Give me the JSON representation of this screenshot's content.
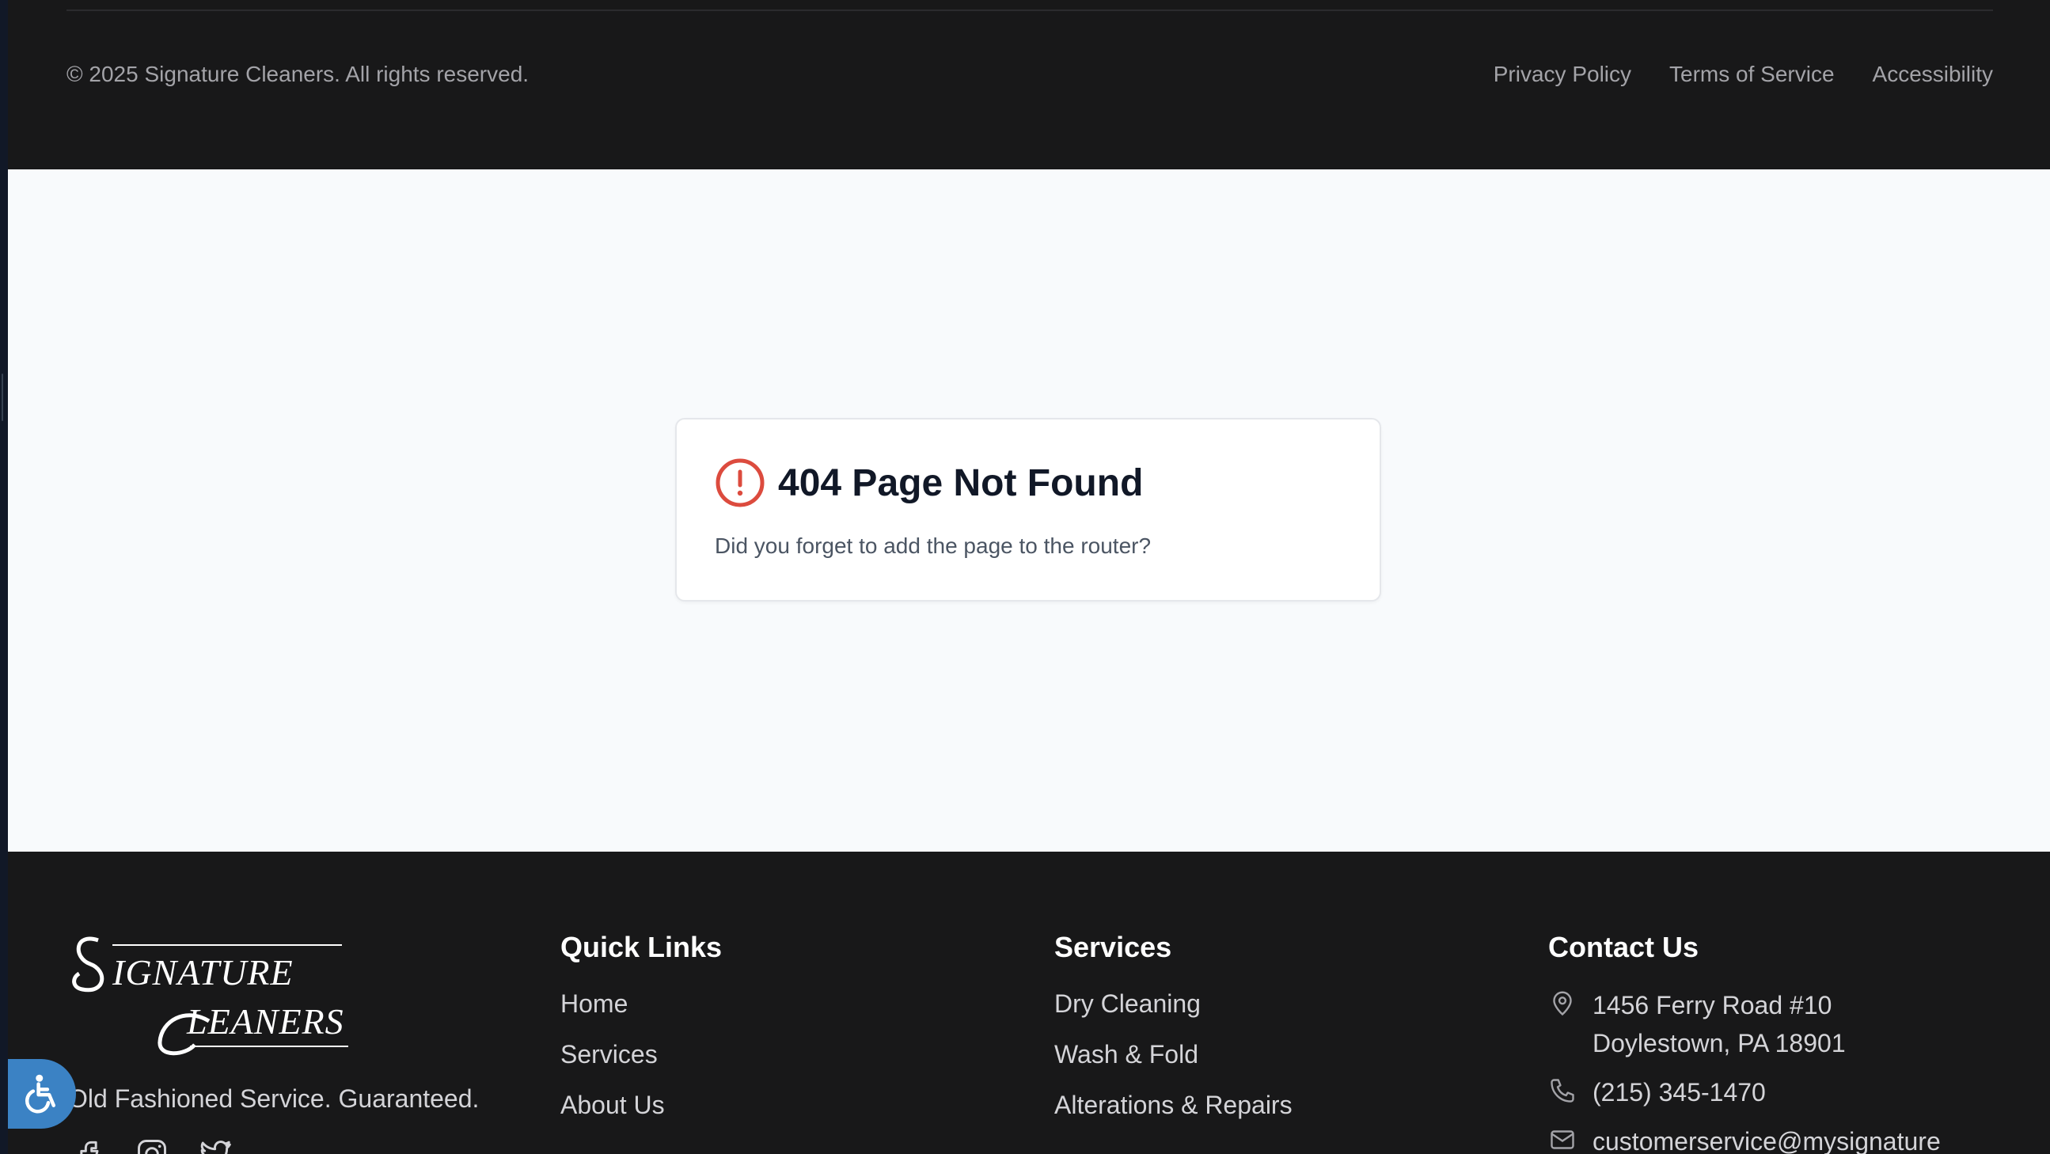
{
  "top_footer": {
    "copyright": "© 2025 Signature Cleaners. All rights reserved.",
    "legal_links": [
      "Privacy Policy",
      "Terms of Service",
      "Accessibility"
    ]
  },
  "error_card": {
    "title": "404 Page Not Found",
    "message": "Did you forget to add the page to the router?",
    "icon": "alert-circle-icon",
    "icon_color": "#dc4b3e"
  },
  "footer": {
    "logo_text": "Signature Cleaners",
    "tagline": "Old Fashioned Service. Guaranteed.",
    "social_icons": [
      "facebook-icon",
      "instagram-icon",
      "twitter-icon"
    ],
    "quick_links": {
      "heading": "Quick Links",
      "items": [
        "Home",
        "Services",
        "About Us"
      ]
    },
    "services": {
      "heading": "Services",
      "items": [
        "Dry Cleaning",
        "Wash & Fold",
        "Alterations & Repairs"
      ]
    },
    "contact": {
      "heading": "Contact Us",
      "address_line1": "1456 Ferry Road #10",
      "address_line2": "Doylestown, PA 18901",
      "phone": "(215) 345-1470",
      "email_partial": "customerservice@mysignature"
    }
  },
  "colors": {
    "footer_bg": "#181819",
    "main_bg": "#f8fafc",
    "accessibility_button": "#3b82c4"
  }
}
